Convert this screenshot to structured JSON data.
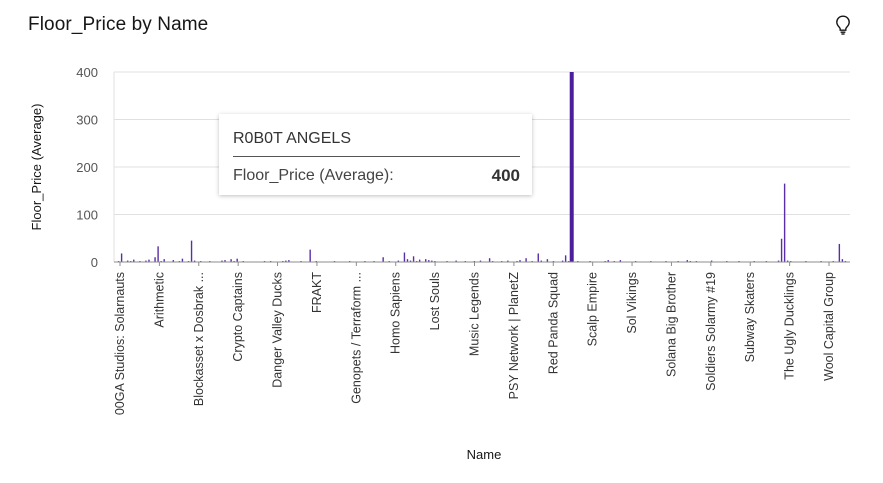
{
  "header": {
    "title": "Floor_Price by Name",
    "insight_icon": "lightbulb-icon"
  },
  "tooltip": {
    "name": "R0B0T ANGELS",
    "label": "Floor_Price (Average):",
    "value": "400"
  },
  "colors": {
    "bar": "#5a2ea6",
    "highlight": "#4b1f9c",
    "grid": "#e0e0e0",
    "axis": "#8d8d8d"
  },
  "chart_data": {
    "type": "bar",
    "title": "Floor_Price by Name",
    "xlabel": "Name",
    "ylabel": "Floor_Price (Average)",
    "ylim": [
      0,
      400
    ],
    "yticks": [
      0,
      100,
      200,
      300,
      400
    ],
    "grid": true,
    "legend": "none",
    "x_tick_labels": [
      "00GA Studios: Solarnauts",
      "Arithmetic",
      "Blockasset x Dosbrak ...",
      "Crypto Captains",
      "Danger Valley Ducks",
      "FRAKT",
      "Genopets / Terraform ...",
      "Homo Sapiens",
      "Lost Souls",
      "Music Legends",
      "PSY Network | PlanetZ",
      "Red Panda Squad",
      "Scalp Empire",
      "Sol Vikings",
      "Solana Big Brother",
      "Soldiers Solarmy #19",
      "Subway Skaters",
      "The Ugly Ducklings",
      "Wool Capital Group"
    ],
    "highlighted": {
      "name": "R0B0T ANGELS",
      "value": 400
    },
    "values": [
      1,
      2,
      18,
      1,
      3,
      2,
      5,
      1,
      2,
      1,
      3,
      5,
      1,
      10,
      33,
      2,
      6,
      1,
      0,
      4,
      1,
      2,
      7,
      1,
      2,
      45,
      3,
      1,
      2,
      1,
      1,
      2,
      1,
      0,
      1,
      3,
      4,
      1,
      6,
      2,
      7,
      1,
      2,
      1,
      0,
      1,
      1,
      0,
      1,
      2,
      1,
      2,
      1,
      0,
      1,
      2,
      3,
      4,
      1,
      1,
      0,
      2,
      1,
      1,
      26,
      1,
      2,
      1,
      0,
      1,
      0,
      1,
      2,
      1,
      0,
      1,
      1,
      2,
      1,
      0,
      1,
      1,
      2,
      1,
      1,
      2,
      1,
      0,
      10,
      1,
      2,
      1,
      1,
      3,
      1,
      20,
      6,
      3,
      12,
      2,
      5,
      1,
      6,
      4,
      3,
      2,
      1,
      0,
      1,
      2,
      1,
      1,
      3,
      1,
      0,
      2,
      1,
      1,
      2,
      1,
      3,
      0,
      1,
      8,
      2,
      1,
      1,
      2,
      1,
      3,
      1,
      1,
      2,
      4,
      1,
      8,
      1,
      2,
      1,
      18,
      3,
      1,
      6,
      1,
      2,
      1,
      1,
      3,
      14,
      2,
      400,
      1,
      2,
      1,
      0,
      1,
      2,
      1,
      0,
      1,
      1,
      2,
      4,
      1,
      2,
      1,
      4,
      1,
      0,
      1,
      1,
      2,
      1,
      0,
      1,
      1,
      2,
      1,
      0,
      1,
      1,
      2,
      1,
      0,
      1,
      2,
      1,
      1,
      4,
      2,
      1,
      2,
      1,
      0,
      1,
      1,
      3,
      1,
      0,
      1,
      1,
      2,
      1,
      0,
      1,
      2,
      1,
      1,
      0,
      1,
      2,
      1,
      0,
      1,
      2,
      1,
      1,
      0,
      3,
      49,
      165,
      3,
      2,
      1,
      0,
      1,
      1,
      2,
      1,
      0,
      1,
      1,
      2,
      1,
      0,
      1,
      2,
      1,
      38,
      6,
      2,
      1
    ]
  }
}
